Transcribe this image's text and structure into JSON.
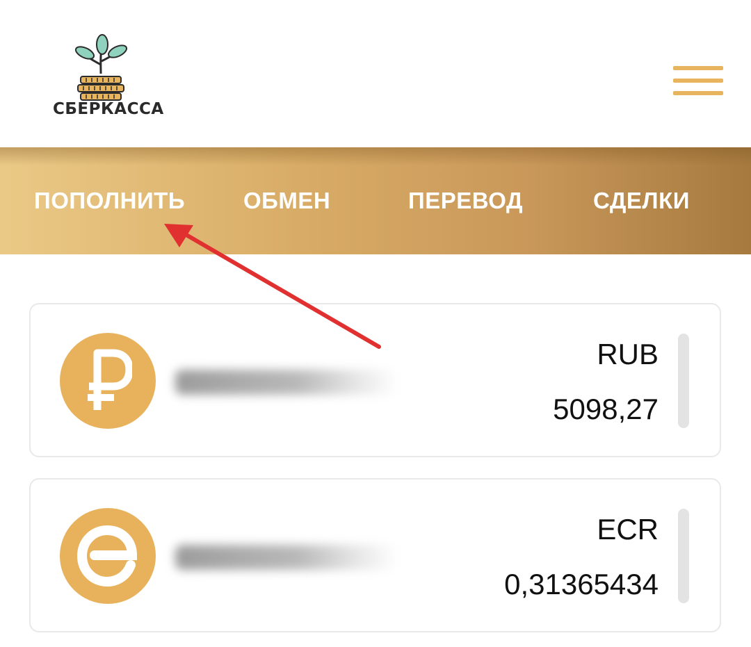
{
  "brand": {
    "name": "СБЕРКАССА",
    "logo_icon": "sprout-on-coins-icon",
    "leaf_color": "#8fd2bd",
    "coin_color": "#e8b45e"
  },
  "header": {
    "menu_icon": "hamburger-menu-icon",
    "menu_color": "#e8b45e"
  },
  "nav": {
    "items": [
      {
        "label": "ПОПОЛНИТЬ"
      },
      {
        "label": "ОБМЕН"
      },
      {
        "label": "ПЕРЕВОД"
      },
      {
        "label": "СДЕЛКИ"
      }
    ],
    "gradient_start": "#eac986",
    "gradient_end": "#a67a3f"
  },
  "annotation": {
    "arrow_color": "#e03030",
    "points_to": "ПОПОЛНИТЬ"
  },
  "wallets": [
    {
      "icon": "ruble-icon",
      "currency": "RUB",
      "amount": "5098,27",
      "wallet_id_blurred": true
    },
    {
      "icon": "ecoin-icon",
      "currency": "ECR",
      "amount": "0,31365434",
      "wallet_id_blurred": true
    }
  ],
  "accent_color": "#e8b25d"
}
